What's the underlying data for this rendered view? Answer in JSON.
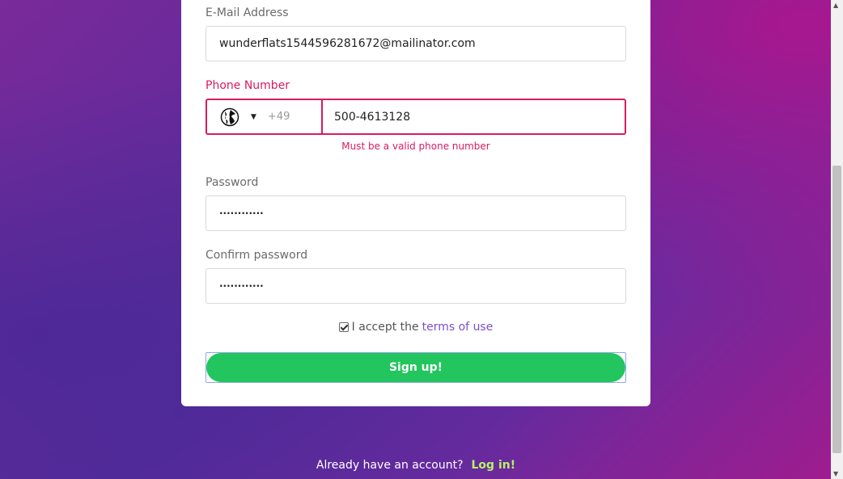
{
  "form": {
    "email_label": "E-Mail Address",
    "email_value": "wunderflats1544596281672@mailinator.com",
    "phone_label": "Phone Number",
    "phone_dial_code": "+49",
    "phone_value": "500-4613128",
    "phone_error": "Must be a valid phone number",
    "password_label": "Password",
    "password_value": "············",
    "confirm_label": "Confirm password",
    "confirm_value": "············",
    "terms_text": "I accept the",
    "terms_link": "terms of use",
    "terms_checked": true,
    "submit_label": "Sign up!"
  },
  "footer": {
    "prompt": "Already have an account?",
    "login_link": "Log in!"
  },
  "colors": {
    "error": "#d81b60",
    "button": "#22c55e",
    "link": "#7b4fc9",
    "login": "#b6f26a"
  },
  "icons": {
    "country": "globe-icon",
    "caret": "caret-down-icon",
    "scroll_up": "arrow-up-icon",
    "scroll_down": "arrow-down-icon"
  }
}
